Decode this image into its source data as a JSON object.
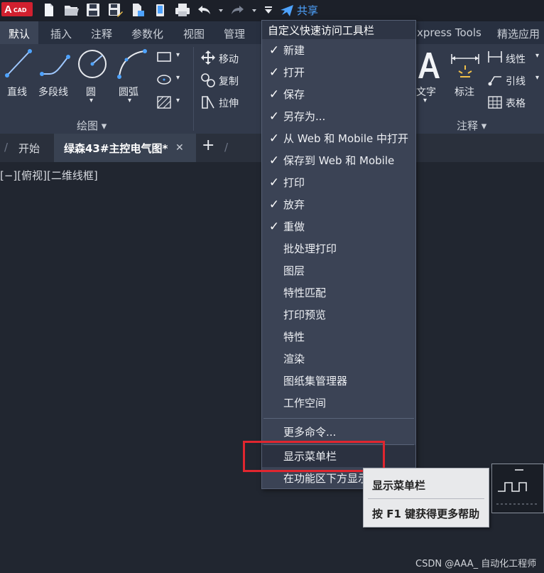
{
  "app": {
    "logo_letter": "A",
    "logo_text": "CAD"
  },
  "qat": {
    "share_label": "共享"
  },
  "tabs": [
    "默认",
    "插入",
    "注释",
    "参数化",
    "视图",
    "管理",
    "xpress Tools",
    "精选应用"
  ],
  "ribbon": {
    "line": "直线",
    "polyline": "多段线",
    "circle": "圆",
    "arc": "圆弧",
    "draw_panel": "绘图 ▾",
    "move": "移动",
    "copy": "复制",
    "stretch": "拉伸",
    "text": "文字",
    "dimension": "标注",
    "linear": "线性",
    "leader": "引线",
    "table": "表格",
    "annotate_panel": "注释 ▾"
  },
  "doc_tabs": {
    "start": "开始",
    "active": "绿森43#主控电气图*",
    "close": "✕",
    "add": "+"
  },
  "viewport_label": "[−][俯视][二维线框]",
  "menu": {
    "header": "自定义快速访问工具栏",
    "items": [
      {
        "label": "新建",
        "check": "✓"
      },
      {
        "label": "打开",
        "check": "✓"
      },
      {
        "label": "保存",
        "check": "✓"
      },
      {
        "label": "另存为...",
        "check": "✓"
      },
      {
        "label": "从 Web 和 Mobile 中打开",
        "check": "✓"
      },
      {
        "label": "保存到 Web 和 Mobile",
        "check": "✓"
      },
      {
        "label": "打印",
        "check": "✓"
      },
      {
        "label": "放弃",
        "check": "✓"
      },
      {
        "label": "重做",
        "check": "✓"
      },
      {
        "label": "批处理打印",
        "check": ""
      },
      {
        "label": "图层",
        "check": ""
      },
      {
        "label": "特性匹配",
        "check": ""
      },
      {
        "label": "打印预览",
        "check": ""
      },
      {
        "label": "特性",
        "check": ""
      },
      {
        "label": "渲染",
        "check": ""
      },
      {
        "label": "图纸集管理器",
        "check": ""
      },
      {
        "label": "工作空间",
        "check": ""
      }
    ],
    "more": "更多命令...",
    "show_menubar": "显示菜单栏",
    "below_ribbon": "在功能区下方显示"
  },
  "tooltip": {
    "title": "显示菜单栏",
    "help": "按 F1 键获得更多帮助"
  },
  "watermark": "CSDN @AAA_ 自动化工程师"
}
